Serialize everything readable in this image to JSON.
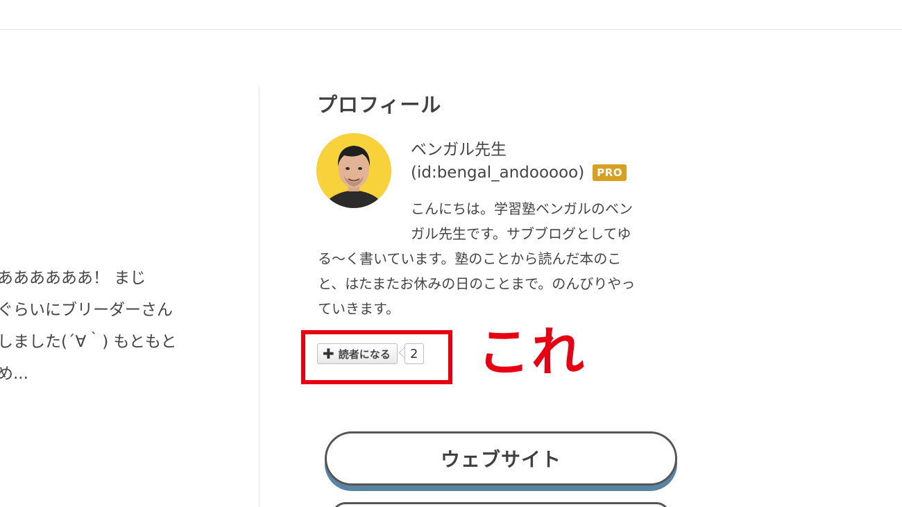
{
  "excerpt": {
    "lines": [
      "ああああああ！ まじ",
      "ぐらいにブリーダーさん",
      "しました(´∀｀) もともと",
      "め..."
    ]
  },
  "profile": {
    "heading": "プロフィール",
    "name": "ベンガル先生",
    "id": "(id:bengal_andooooo)",
    "badge": "PRO",
    "description_lines": [
      "こんにちは。学習塾ベンガルのベン",
      "ガル先生です。サブブログとしてゆ",
      "る〜く書いています。塾のことから読んだ本のこ",
      "と、はたまたお休みの日のことまで。のんびりやっ",
      "ていきます。"
    ]
  },
  "subscribe": {
    "icon": "plus-icon",
    "label": "読者になる",
    "count": "2"
  },
  "annotation": {
    "text": "これ",
    "color": "#e60012"
  },
  "buttons": {
    "website": "ウェブサイト"
  },
  "colors": {
    "pro_badge": "#d7a021",
    "avatar_bg": "#f7d23a",
    "button_shadow": "#5a84a3"
  }
}
